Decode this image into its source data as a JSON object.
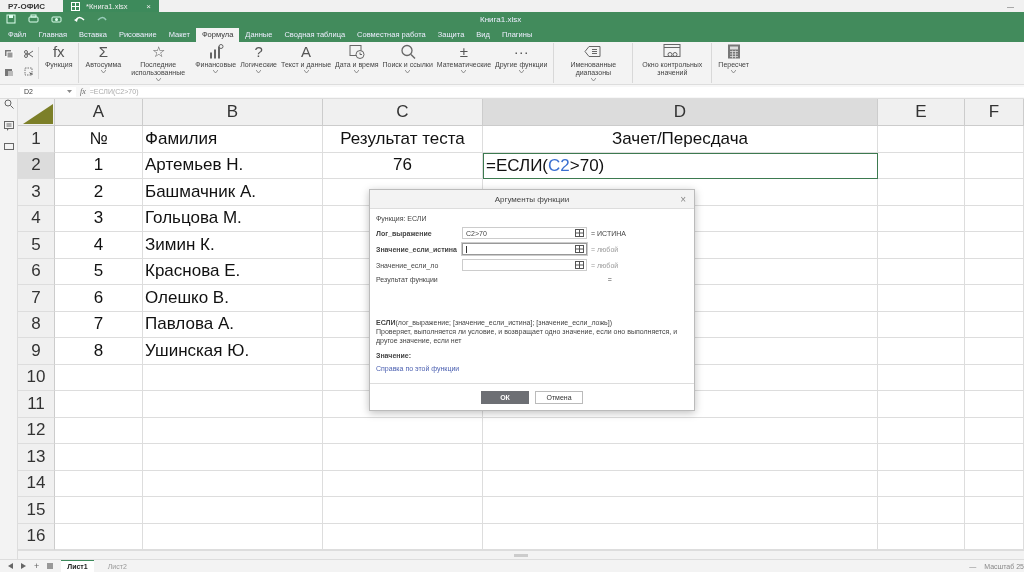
{
  "app": {
    "logo": "Р7-ОФИС",
    "doc_tab": {
      "label": "*Книга1.xlsx",
      "close": "×"
    },
    "minimize": "—"
  },
  "title": "Книга1.xlsx",
  "menu": [
    {
      "label": "Файл",
      "selected": false
    },
    {
      "label": "Главная",
      "selected": false
    },
    {
      "label": "Вставка",
      "selected": false
    },
    {
      "label": "Рисование",
      "selected": false
    },
    {
      "label": "Макет",
      "selected": false
    },
    {
      "label": "Формула",
      "selected": true
    },
    {
      "label": "Данные",
      "selected": false
    },
    {
      "label": "Сводная таблица",
      "selected": false
    },
    {
      "label": "Совместная работа",
      "selected": false
    },
    {
      "label": "Защита",
      "selected": false
    },
    {
      "label": "Вид",
      "selected": false
    },
    {
      "label": "Плагины",
      "selected": false
    }
  ],
  "ribbon": [
    {
      "label": "Функция",
      "glyph": "fx",
      "dropdown": false,
      "group_end": true
    },
    {
      "label": "Автосумма",
      "glyph": "Σ",
      "dropdown": true,
      "group_end": false
    },
    {
      "label": "Последние использованные",
      "glyph": "☆",
      "dropdown": true,
      "group_end": false
    },
    {
      "label": "Финансовые",
      "kind": "chart",
      "dropdown": true,
      "group_end": false
    },
    {
      "label": "Логические",
      "glyph": "?",
      "dropdown": true,
      "group_end": false
    },
    {
      "label": "Текст и данные",
      "glyph": "A",
      "dropdown": true,
      "group_end": false
    },
    {
      "label": "Дата и время",
      "kind": "calendar",
      "dropdown": true,
      "group_end": false
    },
    {
      "label": "Поиск и ссылки",
      "kind": "search",
      "dropdown": true,
      "group_end": false
    },
    {
      "label": "Математические",
      "glyph": "±",
      "dropdown": true,
      "group_end": false
    },
    {
      "label": "Другие функции",
      "glyph": "···",
      "dropdown": true,
      "group_end": true
    },
    {
      "label": "Именованные диапазоны",
      "kind": "tag",
      "dropdown": true,
      "group_end": true
    },
    {
      "label": "Окно контрольных значений",
      "kind": "watch",
      "dropdown": false,
      "group_end": true
    },
    {
      "label": "Пересчет",
      "kind": "calc",
      "dropdown": true,
      "group_end": false
    }
  ],
  "formula_bar": {
    "cell": "D2",
    "fx": "fx",
    "formula": "=ЕСЛИ(C2>70)"
  },
  "columns": [
    "A",
    "B",
    "C",
    "D",
    "E",
    "F"
  ],
  "rows": [
    {
      "num": "1",
      "cells": [
        "№",
        "Фамилия",
        "Результат теста",
        "Зачет/Пересдача"
      ],
      "selected": false
    },
    {
      "num": "2",
      "cells": [
        "1",
        "Артемьев Н.",
        "76"
      ],
      "selected": true
    },
    {
      "num": "3",
      "cells": [
        "2",
        "Башмачник А."
      ],
      "selected": false
    },
    {
      "num": "4",
      "cells": [
        "3",
        "Гольцова М."
      ],
      "selected": false
    },
    {
      "num": "5",
      "cells": [
        "4",
        "Зимин К."
      ],
      "selected": false
    },
    {
      "num": "6",
      "cells": [
        "5",
        "Краснова Е."
      ],
      "selected": false
    },
    {
      "num": "7",
      "cells": [
        "6",
        "Олешко В."
      ],
      "selected": false
    },
    {
      "num": "8",
      "cells": [
        "7",
        "Павлова А."
      ],
      "selected": false
    },
    {
      "num": "9",
      "cells": [
        "8",
        "Ушинская Ю."
      ],
      "selected": false
    },
    {
      "num": "10",
      "cells": [],
      "selected": false
    },
    {
      "num": "11",
      "cells": [],
      "selected": false
    },
    {
      "num": "12",
      "cells": [],
      "selected": false
    },
    {
      "num": "13",
      "cells": [],
      "selected": false
    },
    {
      "num": "14",
      "cells": [],
      "selected": false
    },
    {
      "num": "15",
      "cells": [],
      "selected": false
    },
    {
      "num": "16",
      "cells": [],
      "selected": false
    }
  ],
  "editor": [
    {
      "text": "=ЕСЛИ(",
      "kind": "plain"
    },
    {
      "text": "C2",
      "kind": "ref"
    },
    {
      "text": ">70)",
      "kind": "plain"
    }
  ],
  "dialog": {
    "title": "Аргументы функции",
    "close": "×",
    "function_label": "Функция: ЕСЛИ",
    "args": [
      {
        "label": "Лог_выражение",
        "value": "C2>70",
        "result": "= ИСТИНА",
        "focused": false,
        "bold": true
      },
      {
        "label": "Значение_если_истина",
        "result": "= любой",
        "focused": true,
        "bold": true
      },
      {
        "label": "Значение_если_ло",
        "result": "= любой",
        "focused": false,
        "bold": false
      }
    ],
    "result_label": "Результат функции",
    "result_value": "=",
    "syntax": "**ЕСЛИ**(лог_выражение; [значение_если_истина]; [значение_если_ложь])",
    "description": "Проверяет, выполняется ли условие, и возвращает одно значение, если оно выполняется, и другое значение, если нет",
    "value_label": "Значение:",
    "help_link": "Справка по этой функции",
    "ok": "ОК",
    "cancel": "Отмена"
  },
  "sheets": [
    {
      "label": "Лист1",
      "selected": true
    },
    {
      "label": "Лист2",
      "selected": false
    }
  ],
  "sheet_nav": {
    "add": "+"
  },
  "zoom": {
    "minus": "—",
    "label": "Масштаб 25"
  }
}
